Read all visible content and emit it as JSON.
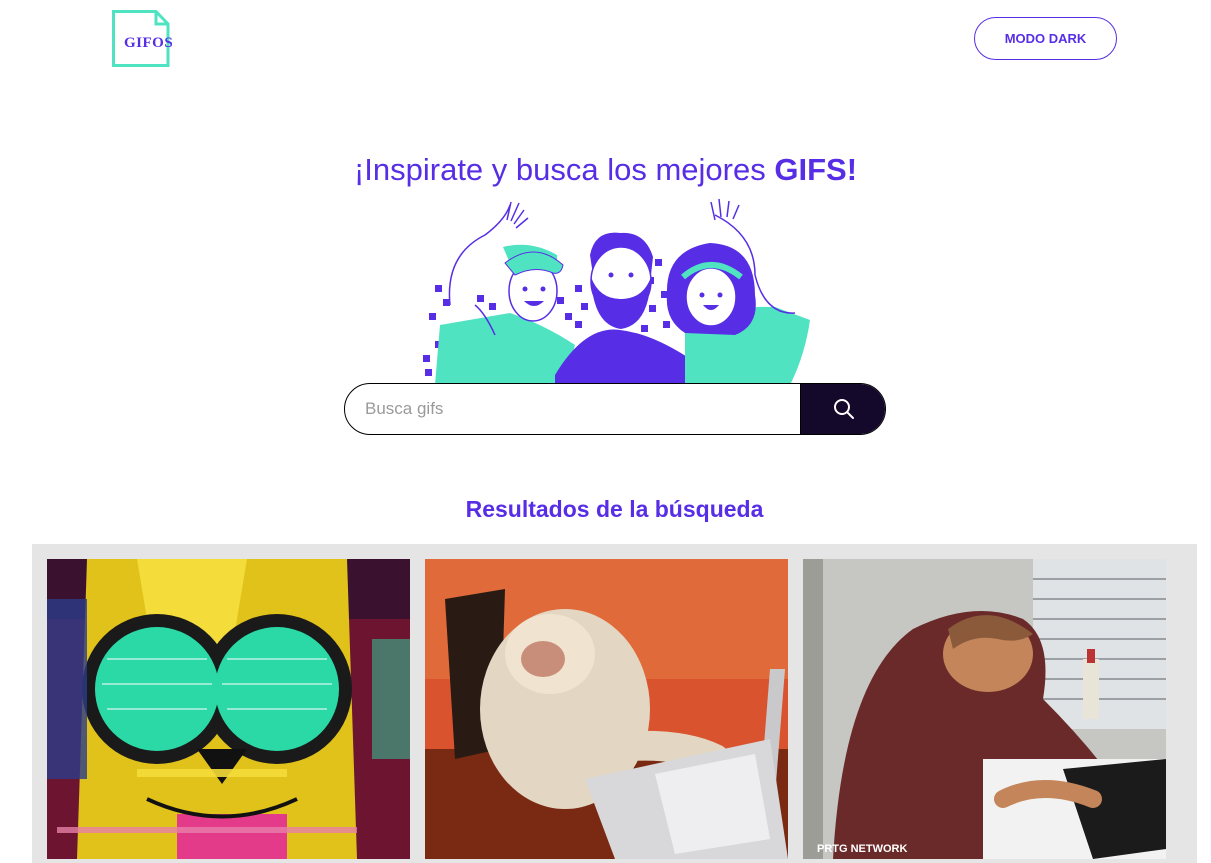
{
  "header": {
    "logo_text": "GIFOS",
    "mode_button": "MODO DARK"
  },
  "hero": {
    "title_prefix": "¡Inspirate y busca los mejores ",
    "title_bold": "GIFS!"
  },
  "search": {
    "placeholder": "Busca gifs",
    "value": ""
  },
  "results": {
    "title": "Resultados de la búsqueda",
    "gif_watermark": "PRTG NETWORK"
  },
  "colors": {
    "accent": "#572ee5",
    "teal": "#50e3c2",
    "search_button": "#14082b"
  }
}
